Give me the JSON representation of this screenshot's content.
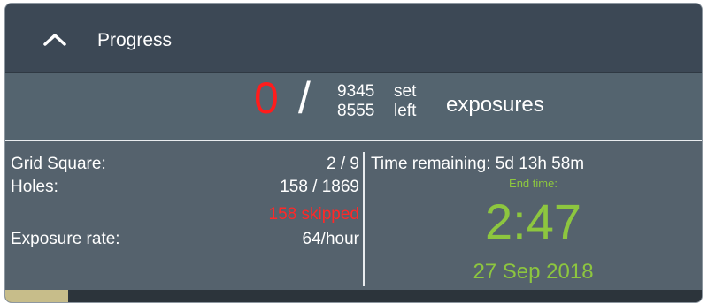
{
  "panel": {
    "title": "Progress",
    "collapse_icon": "chevron-up-icon"
  },
  "summary": {
    "completed": "0",
    "separator": "/",
    "set_count": "9345",
    "set_label": "set",
    "left_count": "8555",
    "left_label": "left",
    "unit_label": "exposures"
  },
  "stats": {
    "grid_square_label": "Grid Square:",
    "grid_square_value": "2 / 9",
    "holes_label": "Holes:",
    "holes_value": "158 / 1869",
    "skipped_text": "158 skipped",
    "exposure_rate_label": "Exposure rate:",
    "exposure_rate_value": "64/hour"
  },
  "timing": {
    "time_remaining_text": "Time remaining: 5d 13h 58m",
    "end_time_caption": "End time:",
    "end_time": "2:47",
    "end_date": "27 Sep 2018"
  },
  "progress": {
    "fraction": 0.09
  },
  "colors": {
    "completed": "#ff1c1c",
    "skipped": "#ff2828",
    "end_time": "#8dc63f",
    "progress_fill": "#c7bd8a"
  }
}
